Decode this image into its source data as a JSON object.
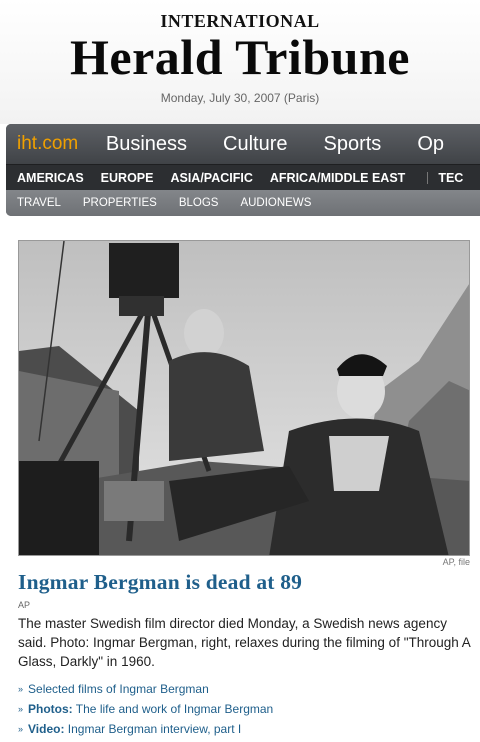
{
  "masthead": {
    "line1": "INTERNATIONAL",
    "line2": "Herald Tribune",
    "date": "Monday, July 30, 2007 (Paris)"
  },
  "nav": {
    "logo": "iht.com",
    "categories": [
      "Business",
      "Culture",
      "Sports",
      "Op"
    ],
    "regions": [
      "AMERICAS",
      "EUROPE",
      "ASIA/PACIFIC",
      "AFRICA/MIDDLE EAST",
      "TEC"
    ],
    "sub": [
      "TRAVEL",
      "PROPERTIES",
      "BLOGS",
      "AUDIONEWS"
    ]
  },
  "photo": {
    "credit": "AP, file"
  },
  "article": {
    "headline": "Ingmar Bergman is dead at 89",
    "byline": "AP",
    "summary": "The master Swedish film director died Monday, a Swedish news agency said. Photo: Ingmar Bergman, right, relaxes during the filming of \"Through A Glass, Darkly\" in 1960.",
    "links": [
      {
        "lead": "",
        "text": "Selected films of Ingmar Bergman"
      },
      {
        "lead": "Photos:",
        "text": " The life and work of Ingmar Bergman"
      },
      {
        "lead": "Video:",
        "text": " Ingmar Bergman interview, part I"
      }
    ]
  },
  "colors": {
    "link": "#1f5f8b",
    "logo": "#f0a000",
    "nav_bar": "#4b4e52"
  }
}
